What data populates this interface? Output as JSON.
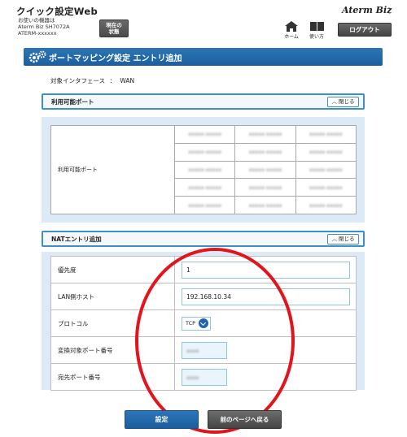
{
  "header": {
    "app_title": "クイック設定Web",
    "device_label": "お使いの機器は",
    "device_model": "Aterm Biz SH7072A",
    "device_name": "ATERM-xxxxxx",
    "status_button": [
      "現在の",
      "状態"
    ],
    "brand": "Aterm Biz",
    "home_label": "ホーム",
    "help_label": "使い方",
    "logout_label": "ログアウト"
  },
  "page": {
    "title": "ポートマッピング設定 エントリ追加",
    "interface_label": "対象インタフェース",
    "interface_sep": "：",
    "interface_value": "WAN"
  },
  "available_ports": {
    "section_title": "利用可能ポート",
    "close_label": "閉じる",
    "row_label": "利用可能ポート",
    "cells": [
      [
        "xxxxx-xxxxx",
        "xxxxx-xxxxx",
        "xxxxx-xxxxx"
      ],
      [
        "xxxxx-xxxxx",
        "xxxxx-xxxxx",
        "xxxxx-xxxxx"
      ],
      [
        "xxxxx-xxxxx",
        "xxxxx-xxxxx",
        "xxxxx-xxxxx"
      ],
      [
        "xxxxx-xxxxx",
        "xxxxx-xxxxx",
        "xxxxx-xxxxx"
      ],
      [
        "xxxxx-xxxxx",
        "xxxxx-xxxxx",
        "xxxxx-xxxxx"
      ]
    ]
  },
  "nat_entry": {
    "section_title": "NATエントリ追加",
    "close_label": "閉じる",
    "priority_label": "優先度",
    "priority_value": "1",
    "lan_host_label": "LAN側ホスト",
    "lan_host_value": "192.168.10.34",
    "protocol_label": "プロトコル",
    "protocol_value": "TCP",
    "conv_port_label": "変換対象ポート番号",
    "conv_port_value": "xxxx",
    "dest_port_label": "宛先ポート番号",
    "dest_port_value": "xxxx"
  },
  "buttons": {
    "submit_label": "設定",
    "back_label": "前のページへ戻る"
  },
  "colors": {
    "accent_blue": "#1f63ad",
    "panel_bg": "#dbeaf6",
    "section_border": "#3e8fc8",
    "annotation_red": "#e2141c"
  },
  "icons": {
    "home": "home-icon",
    "help": "book-icon",
    "title": "gear-icon",
    "close": "chevron-up-icon",
    "select": "chevron-down-icon"
  }
}
